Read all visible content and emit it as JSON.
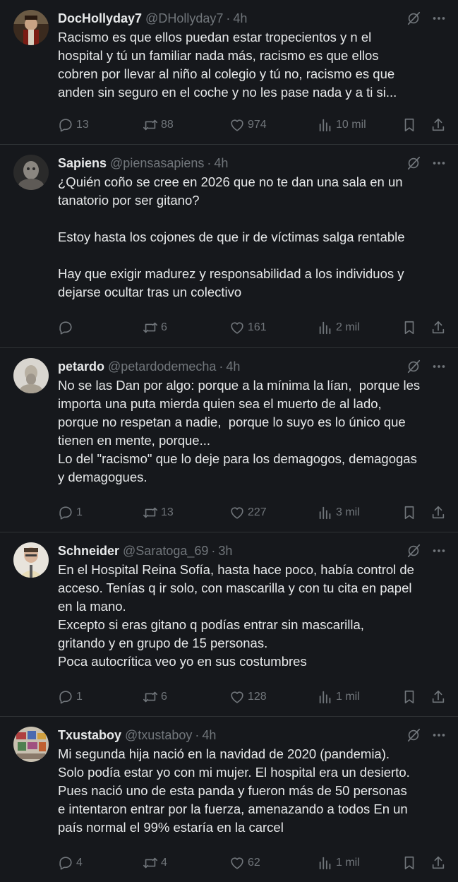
{
  "posts": [
    {
      "name": "DocHollyday7",
      "handle": "@DHollyday7",
      "sep": "·",
      "time": "4h",
      "text": "Racismo es que ellos puedan estar tropecientos y n el\nhospital y tú un familiar nada más, racismo es que ellos\ncobren por llevar al niño al colegio y tú no, racismo es que\nanden sin seguro en el coche y no les pase nada y a ti si...",
      "replies": "13",
      "reposts": "88",
      "likes": "974",
      "views": "10 mil"
    },
    {
      "name": "Sapiens",
      "handle": "@piensasapiens",
      "sep": "·",
      "time": "4h",
      "text": "¿Quién coño se cree en 2026 que no te dan una sala en un\ntanatorio por ser gitano?\n\nEstoy hasta los cojones de que ir de víctimas salga rentable\n\nHay que exigir madurez y responsabilidad a los individuos y\ndejarse ocultar tras un colectivo",
      "replies": "",
      "reposts": "6",
      "likes": "161",
      "views": "2 mil"
    },
    {
      "name": "petardo",
      "handle": "@petardodemecha",
      "sep": "·",
      "time": "4h",
      "text": "No se las Dan por algo: porque a la mínima la lían,  porque les\nimporta una puta mierda quien sea el muerto de al lado,\nporque no respetan a nadie,  porque lo suyo es lo único que\ntienen en mente, porque...\nLo del \"racismo\" que lo deje para los demagogos, demagogas\ny demagogues.",
      "replies": "1",
      "reposts": "13",
      "likes": "227",
      "views": "3 mil"
    },
    {
      "name": "Schneider",
      "handle": "@Saratoga_69",
      "sep": "·",
      "time": "3h",
      "text": "En el Hospital Reina Sofía, hasta hace poco, había control de\nacceso. Tenías q ir solo, con mascarilla y con tu cita en papel\nen la mano.\nExcepto si eras gitano q podías entrar sin mascarilla,\ngritando y en grupo de 15 personas.\nPoca autocrítica veo yo en sus costumbres",
      "replies": "1",
      "reposts": "6",
      "likes": "128",
      "views": "1 mil"
    },
    {
      "name": "Txustaboy",
      "handle": "@txustaboy",
      "sep": "·",
      "time": "4h",
      "text": "Mi segunda hija nació en la navidad de 2020 (pandemia).\nSolo podía estar yo con mi mujer. El hospital era un desierto.\nPues nació uno de esta panda y fueron más de 50 personas\ne intentaron entrar por la fuerza, amenazando a todos En un\npaís normal el 99% estaría en la carcel",
      "replies": "4",
      "reposts": "4",
      "likes": "62",
      "views": "1 mil"
    }
  ],
  "icons": {
    "reply": "reply-icon",
    "repost": "repost-icon",
    "like": "heart-icon",
    "views": "views-icon",
    "bookmark": "bookmark-icon",
    "share": "share-icon",
    "grok": "grok-icon",
    "more": "more-icon"
  },
  "colors": {
    "background": "#16181c",
    "text": "#e7e9ea",
    "muted": "#71767b",
    "divider": "#2f3336"
  }
}
